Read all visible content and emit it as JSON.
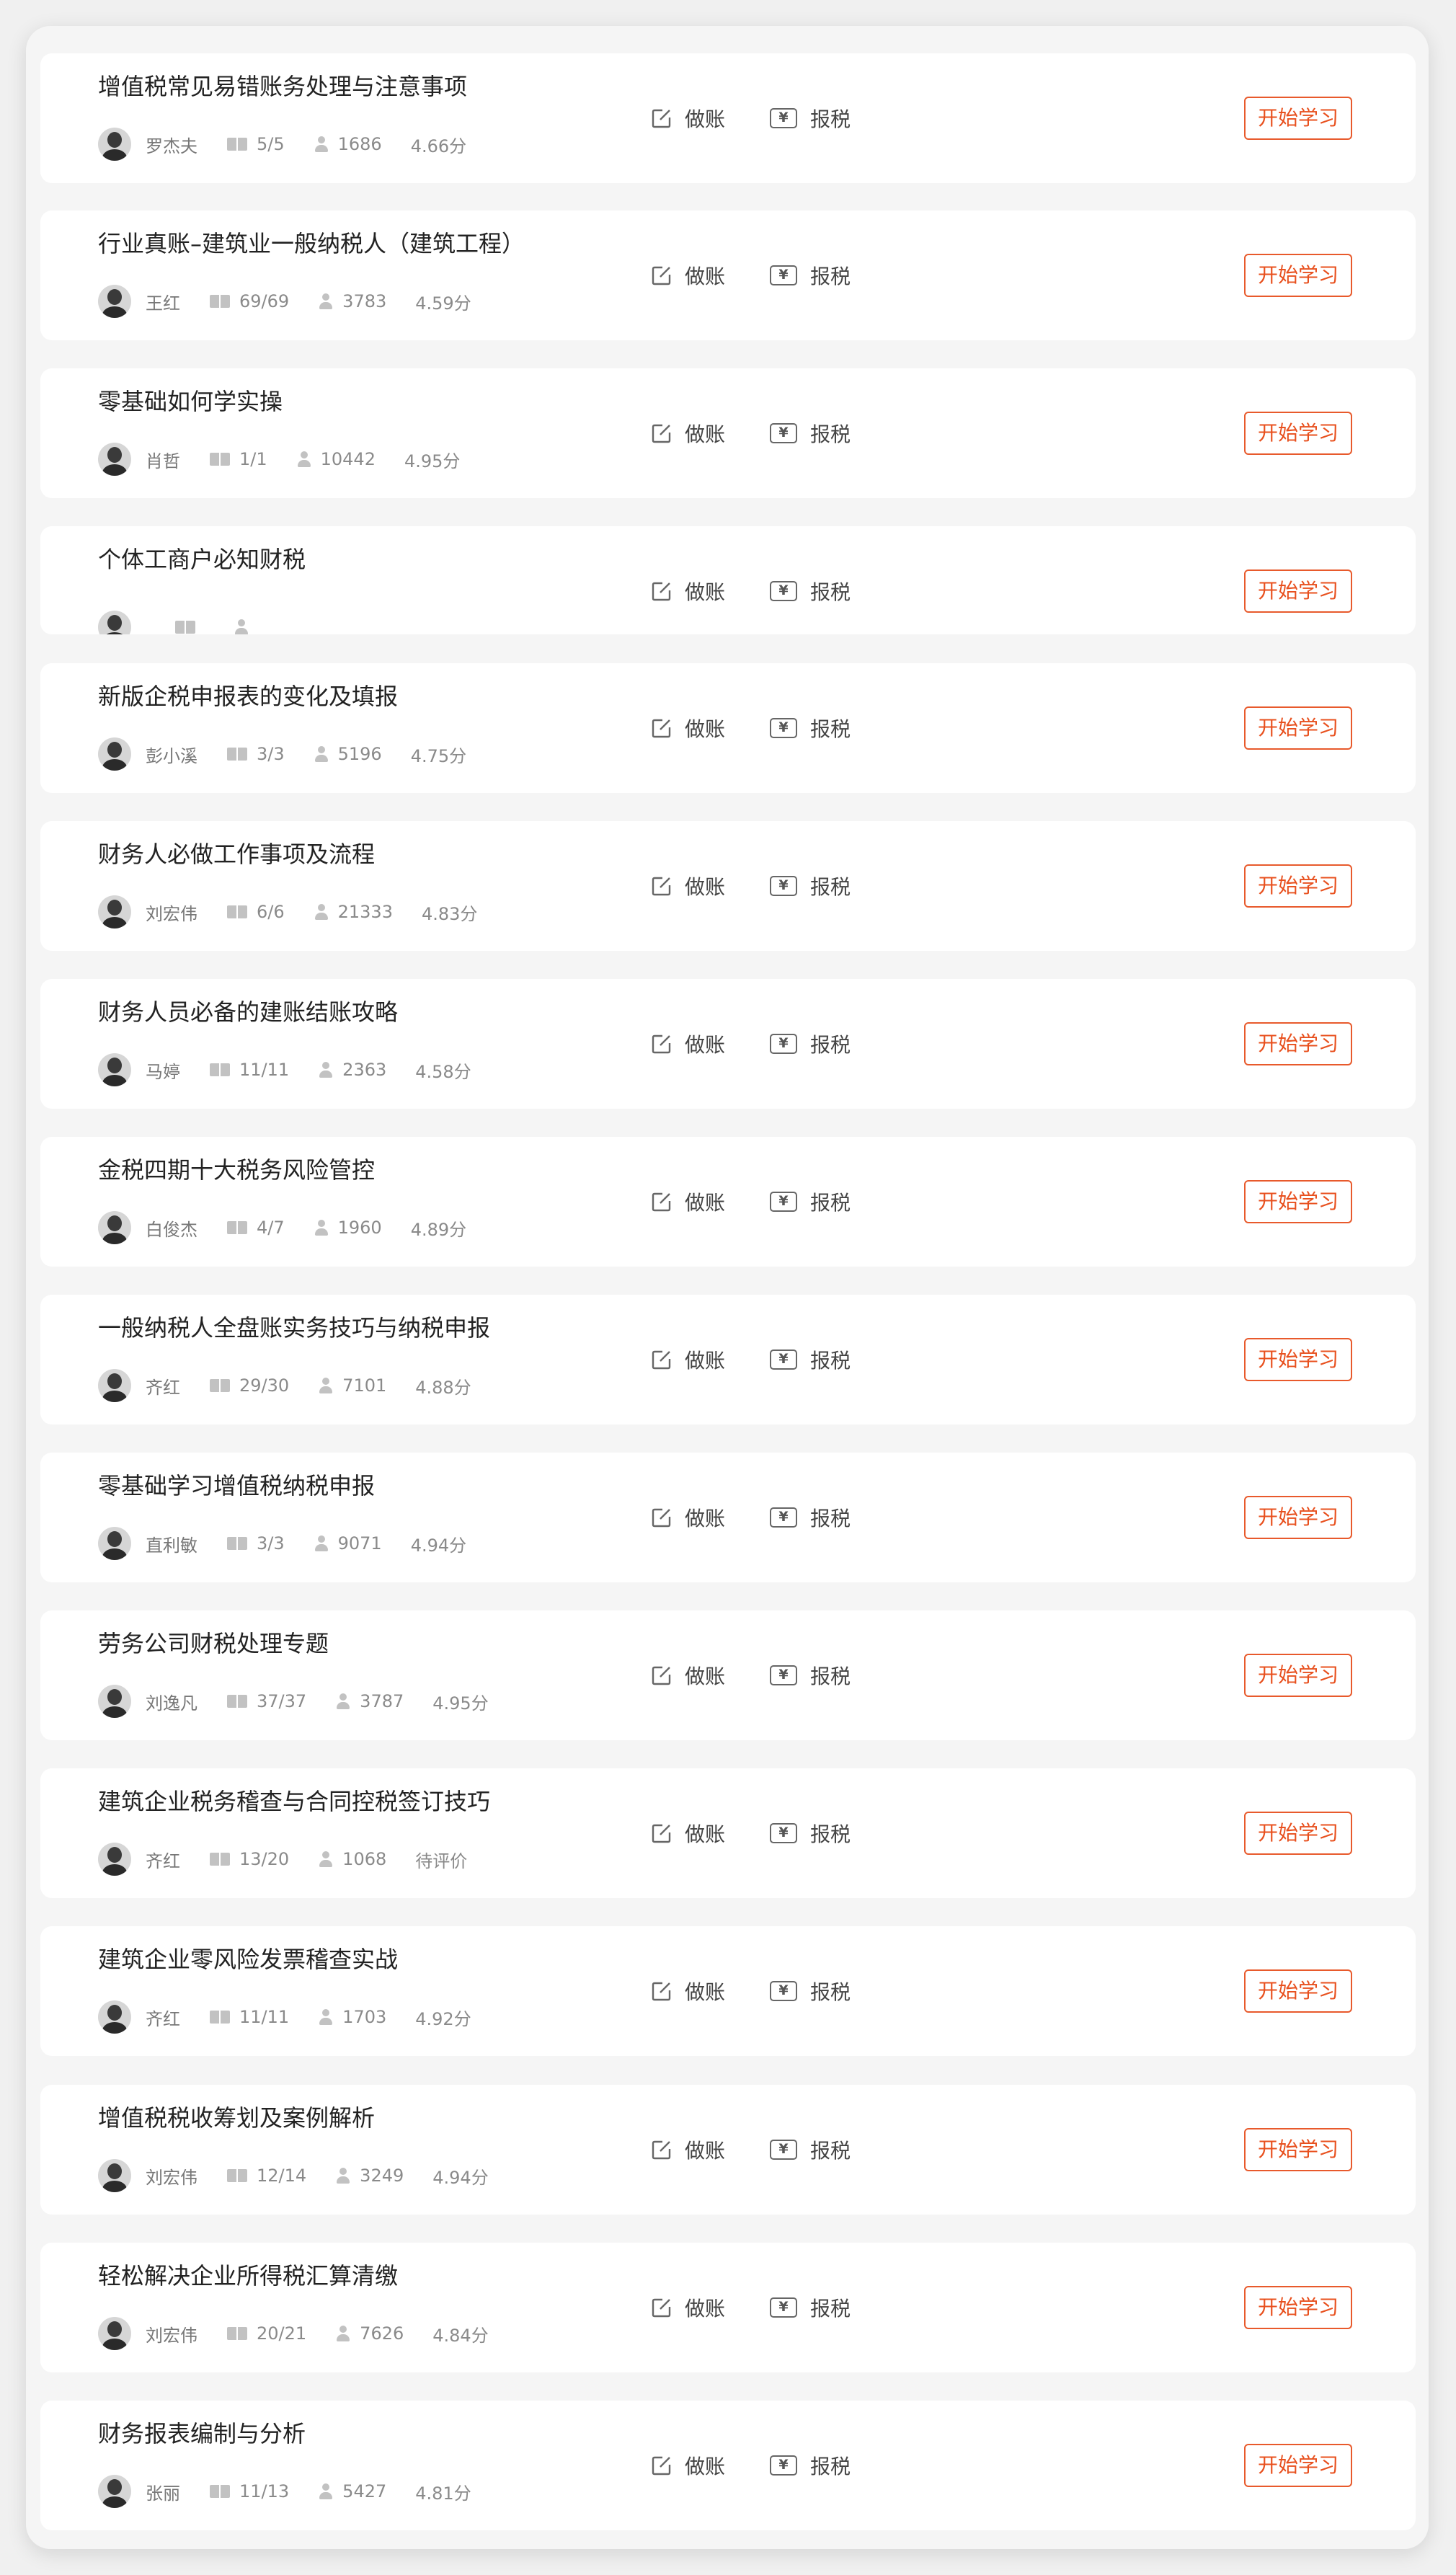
{
  "courses": [
    {
      "title": "增值税常见易错账务处理与注意事项",
      "teacher": "罗杰夫",
      "progress": "5/5",
      "learners": "1686",
      "rating": "4.66分"
    },
    {
      "title": "行业真账–建筑业一般纳税人（建筑工程）",
      "teacher": "王红",
      "progress": "69/69",
      "learners": "3783",
      "rating": "4.59分"
    },
    {
      "title": "零基础如何学实操",
      "teacher": "肖哲",
      "progress": "1/1",
      "learners": "10442",
      "rating": "4.95分"
    },
    {
      "title": "个体工商户必知财税",
      "teacher": "",
      "progress": "",
      "learners": "",
      "rating": ""
    },
    {
      "title": "新版企税申报表的变化及填报",
      "teacher": "彭小溪",
      "progress": "3/3",
      "learners": "5196",
      "rating": "4.75分"
    },
    {
      "title": "财务人必做工作事项及流程",
      "teacher": "刘宏伟",
      "progress": "6/6",
      "learners": "21333",
      "rating": "4.83分"
    },
    {
      "title": "财务人员必备的建账结账攻略",
      "teacher": "马婷",
      "progress": "11/11",
      "learners": "2363",
      "rating": "4.58分"
    },
    {
      "title": "金税四期十大税务风险管控",
      "teacher": "白俊杰",
      "progress": "4/7",
      "learners": "1960",
      "rating": "4.89分"
    },
    {
      "title": "一般纳税人全盘账实务技巧与纳税申报",
      "teacher": "齐红",
      "progress": "29/30",
      "learners": "7101",
      "rating": "4.88分"
    },
    {
      "title": "零基础学习增值税纳税申报",
      "teacher": "直利敏",
      "progress": "3/3",
      "learners": "9071",
      "rating": "4.94分"
    },
    {
      "title": "劳务公司财税处理专题",
      "teacher": "刘逸凡",
      "progress": "37/37",
      "learners": "3787",
      "rating": "4.95分"
    },
    {
      "title": "建筑企业税务稽查与合同控税签订技巧",
      "teacher": "齐红",
      "progress": "13/20",
      "learners": "1068",
      "rating": "待评价"
    },
    {
      "title": "建筑企业零风险发票稽查实战",
      "teacher": "齐红",
      "progress": "11/11",
      "learners": "1703",
      "rating": "4.92分"
    },
    {
      "title": "增值税税收筹划及案例解析",
      "teacher": "刘宏伟",
      "progress": "12/14",
      "learners": "3249",
      "rating": "4.94分"
    },
    {
      "title": "轻松解决企业所得税汇算清缴",
      "teacher": "刘宏伟",
      "progress": "20/21",
      "learners": "7626",
      "rating": "4.84分"
    },
    {
      "title": "财务报表编制与分析",
      "teacher": "张丽",
      "progress": "11/13",
      "learners": "5427",
      "rating": "4.81分"
    }
  ],
  "labels": {
    "zuozhang": "做账",
    "baoshui": "报税",
    "start": "开始学习"
  },
  "icons": {
    "edit": "edit-icon",
    "yen": "yen-icon",
    "yen_glyph": "¥",
    "book": "book-icon",
    "user": "user-icon"
  },
  "colors": {
    "accent": "#e8501e",
    "background": "#f5f5f5",
    "card": "#ffffff"
  }
}
